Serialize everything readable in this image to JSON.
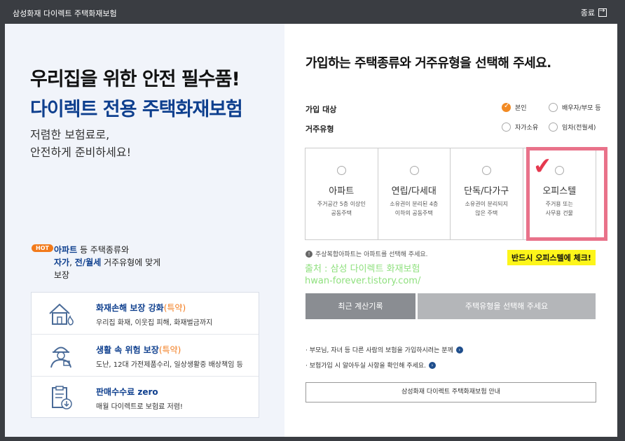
{
  "window": {
    "title": "삼성화재 다이렉트 주택화재보험",
    "close_label": "종료"
  },
  "left": {
    "headline1": "우리집을 위한 안전 필수품!",
    "headline2": "다이렉트 전용 주택화재보험",
    "subtext": "저렴한 보험료로,\n안전하게 준비하세요!",
    "hot_badge": "HOT",
    "hot_desc": {
      "p1": "아파트",
      "p2": " 등 주택종류와",
      "p3": "자가",
      "p4": ", ",
      "p5": "전/월세",
      "p6": " 거주유형에 맞게",
      "p7": "보장"
    },
    "benefits": [
      {
        "icon": "house-fire-icon",
        "title": "화재손해 보장 강화",
        "tag": "(특약)",
        "desc": "우리집 화재, 이웃집 피해, 화재벌금까지"
      },
      {
        "icon": "worker-icon",
        "title": "생활 속 위험 보장",
        "tag": "(특약)",
        "desc": "도난, 12대 가전제품수리, 일상생활중 배상책임 등"
      },
      {
        "icon": "clipboard-download-icon",
        "title": "판매수수료 zero",
        "tag": "",
        "desc": "매월 다이렉트로 보험료 저렴!"
      }
    ]
  },
  "right": {
    "question": "가입하는 주택종류와 거주유형을 선택해 주세요.",
    "enroll_label": "가입 대상",
    "enroll_options": [
      "본인",
      "배우자/부모 등"
    ],
    "residence_label": "거주유형",
    "residence_options": [
      "자가소유",
      "임차(전월세)"
    ],
    "cards": [
      {
        "name": "아파트",
        "desc": "주거공간 5층 이상인\n공동주택"
      },
      {
        "name": "연립/다세대",
        "desc": "소유권이 분리된 4층\n이하의 공동주택"
      },
      {
        "name": "단독/다가구",
        "desc": "소유권이 분리되지\n않은 주택"
      },
      {
        "name": "오피스텔",
        "desc": "주거용 또는\n사무용 건물"
      }
    ],
    "note": "주상복합아파트는 아파트를 선택해 주세요.",
    "annotation": "반드시 오피스텔에 체크!",
    "watermark1": "출처 : 삼성 다이렉트 화재보험",
    "watermark2": "hwan-forever.tistory.com/",
    "btn_history": "최근 계산기록",
    "btn_select": "주택유형을 선택해 주세요",
    "links": [
      "· 부모님, 자녀 등 다른 사람의 보험을 가입하시려는 분께",
      "· 보험가입 시 알아두실 사항을 확인해 주세요."
    ],
    "btn_guide": "삼성화재 다이렉트 주택화재보험 안내"
  },
  "colors": {
    "brand_blue": "#0e3f8e",
    "accent_orange": "#f27a1b",
    "highlight_pink": "#e9728a",
    "check_red": "#e5394f",
    "annotation_yellow": "#fdf51a",
    "watermark_green": "#8fe07e"
  }
}
